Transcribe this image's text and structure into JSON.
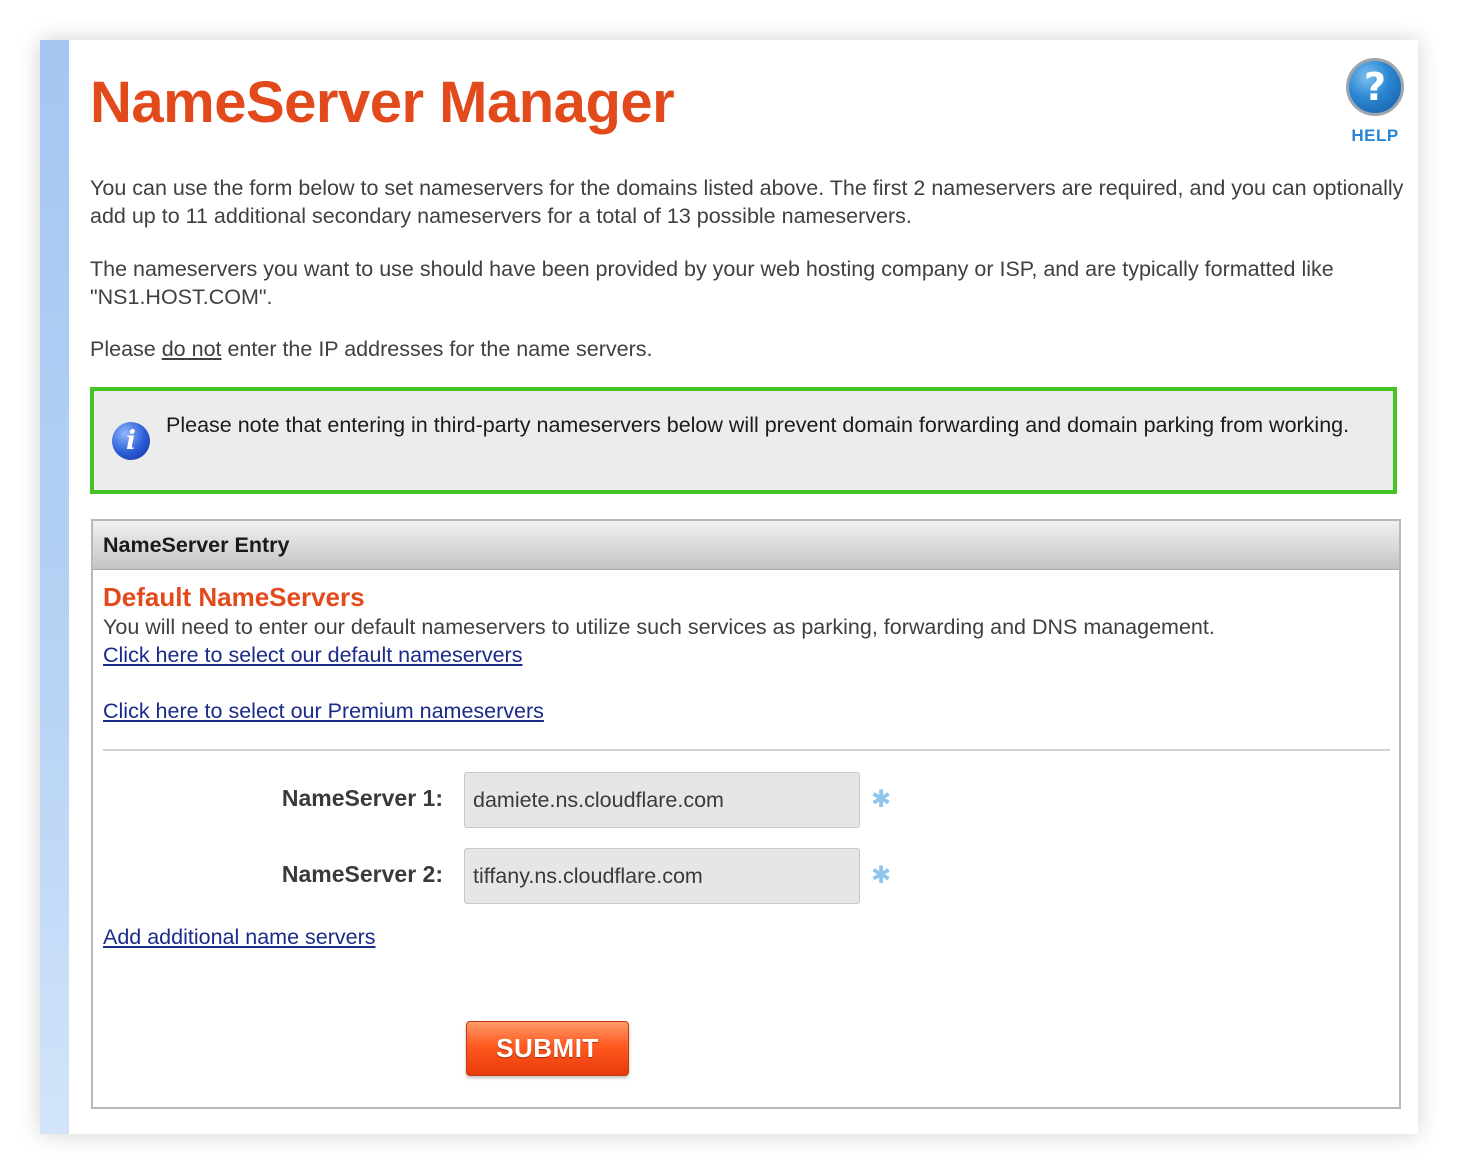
{
  "page": {
    "title": "NameServer Manager"
  },
  "help": {
    "icon_glyph": "?",
    "label": "HELP"
  },
  "intro": {
    "p1": "You can use the form below to set nameservers for the domains listed above. The first 2 nameservers are required, and you can optionally add up to 11 additional secondary nameservers for a total of 13 possible nameservers.",
    "p2": "The nameservers you want to use should have been provided by your web hosting company or ISP, and are typically formatted like \"NS1.HOST.COM\".",
    "p3_before": "Please ",
    "p3_underlined": "do not",
    "p3_after": " enter the IP addresses for the name servers."
  },
  "notice": {
    "icon_glyph": "i",
    "text": "Please note that entering in third-party nameservers below will prevent domain forwarding and domain parking from working."
  },
  "panel": {
    "header": "NameServer Entry",
    "section_title": "Default NameServers",
    "section_desc": "You will need to enter our default nameservers to utilize such services as parking, forwarding and DNS management.",
    "link_default": "Click here to select our default nameservers",
    "link_premium": "Click here to select our Premium nameservers",
    "link_add": "Add additional name servers"
  },
  "form": {
    "ns1": {
      "label": "NameServer 1:",
      "value": "damiete.ns.cloudflare.com",
      "required_marker": "✱"
    },
    "ns2": {
      "label": "NameServer 2:",
      "value": "tiffany.ns.cloudflare.com",
      "required_marker": "✱"
    },
    "submit_label": "SUBMIT"
  },
  "colors": {
    "title": "#e24a1c",
    "notice_border": "#44c322",
    "link": "#1a2a8a",
    "help_blue": "#2a86d2",
    "submit": "#ff5a1f"
  }
}
